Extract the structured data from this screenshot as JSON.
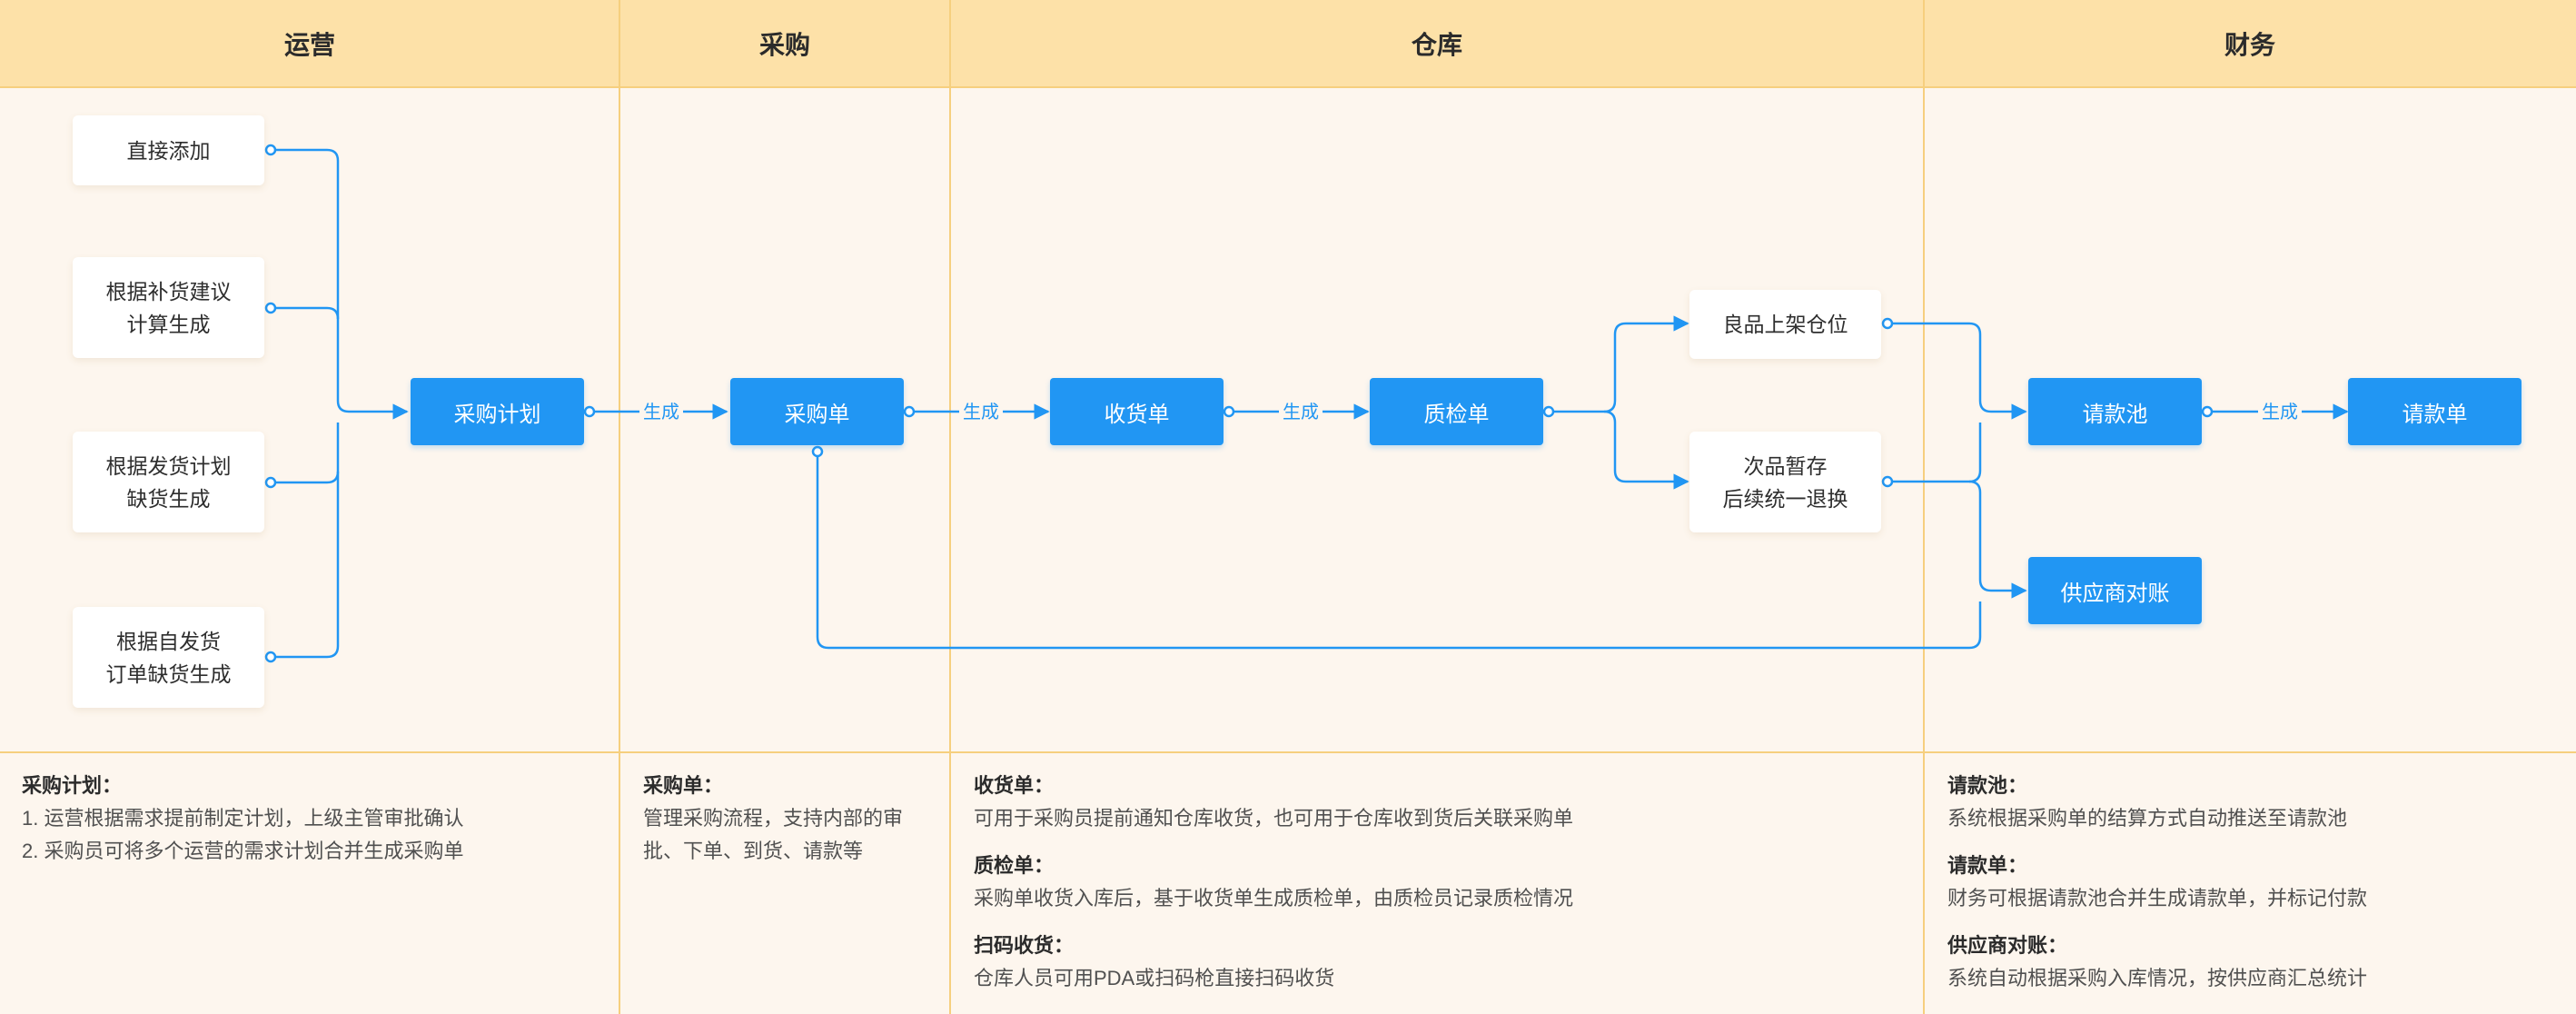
{
  "lanes": {
    "ops": "运营",
    "purchase": "采购",
    "warehouse": "仓库",
    "finance": "财务"
  },
  "cards": {
    "direct_add": "直接添加",
    "replenish": "根据补货建议\n计算生成",
    "ship_plan": "根据发货计划\n缺货生成",
    "self_ship": "根据自发货\n订单缺货生成",
    "good_shelf": "良品上架仓位",
    "defective": "次品暂存\n后续统一退换"
  },
  "nodes": {
    "purchase_plan": "采购计划",
    "purchase_order": "采购单",
    "receipt": "收货单",
    "qc": "质检单",
    "payment_pool": "请款池",
    "payment_request": "请款单",
    "supplier_recon": "供应商对账"
  },
  "edge_labels": {
    "generate": "生成"
  },
  "notes": {
    "ops": {
      "title": "采购计划：",
      "line1": "1. 运营根据需求提前制定计划，上级主管审批确认",
      "line2": "2. 采购员可将多个运营的需求计划合并生成采购单"
    },
    "purchase": {
      "title": "采购单：",
      "line1": "管理采购流程，支持内部的审",
      "line2": "批、下单、到货、请款等"
    },
    "warehouse": {
      "receipt_title": "收货单：",
      "receipt_text": "可用于采购员提前通知仓库收货，也可用于仓库收到货后关联采购单",
      "qc_title": "质检单：",
      "qc_text": "采购单收货入库后，基于收货单生成质检单，由质检员记录质检情况",
      "scan_title": "扫码收货：",
      "scan_text": "仓库人员可用PDA或扫码枪直接扫码收货"
    },
    "finance": {
      "pool_title": "请款池：",
      "pool_text": "系统根据采购单的结算方式自动推送至请款池",
      "request_title": "请款单：",
      "request_text": "财务可根据请款池合并生成请款单，并标记付款",
      "recon_title": "供应商对账：",
      "recon_text": "系统自动根据采购入库情况，按供应商汇总统计"
    }
  },
  "colors": {
    "accent": "#2196f3",
    "header_bg": "#fde1a8",
    "body_bg": "#fdf6ee",
    "divider": "#f6cf7e"
  }
}
